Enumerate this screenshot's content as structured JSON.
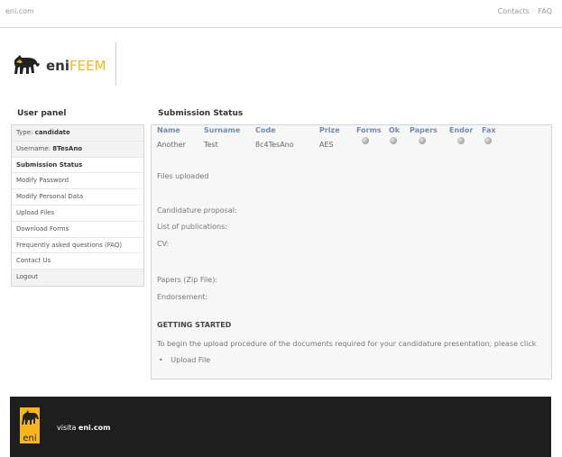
{
  "topbar": {
    "site": "eni.com",
    "contacts": "Contacts",
    "faq": "FAQ"
  },
  "logo": {
    "eni": "eni",
    "feem": "FEEM"
  },
  "sidebar": {
    "title": "User panel",
    "type_label": "Type:",
    "type_value": "candidate",
    "username_label": "Username:",
    "username_value": "8TesAno",
    "items": [
      "Submission Status",
      "Modify Password",
      "Modify Personal Data",
      "Upload Files",
      "Download Forms",
      "Frequently asked questions (FAQ)",
      "Contact Us",
      "Logout"
    ]
  },
  "main": {
    "title": "Submission Status",
    "headers": [
      "Name",
      "Surname",
      "Code",
      "Prize",
      "Forms",
      "Ok",
      "Papers",
      "Endor",
      "Fax"
    ],
    "row": [
      "Another",
      "Test",
      "8c4TesAno",
      "AES"
    ],
    "status_icons": [
      "grey-dot-icon",
      "grey-dot-icon",
      "grey-dot-icon",
      "grey-dot-icon",
      "grey-dot-icon"
    ],
    "files_uploaded": "Files uploaded",
    "candidature": "Candidature proposal:",
    "publications": "List of publications:",
    "cv": "CV:",
    "papers": "Papers (Zip File):",
    "endorsement": "Endorsement:",
    "getting_started": "GETTING STARTED",
    "instructions": "To begin the upload procedure of the documents required for your candidature presentation, please click",
    "upload_link": "Upload File"
  },
  "footer": {
    "visit": "visita",
    "site": "eni.com"
  },
  "colors": {
    "header_blue": "#6f8bb2",
    "accent_yellow": "#f7b61c",
    "footer_bg": "#1e1e1e"
  }
}
